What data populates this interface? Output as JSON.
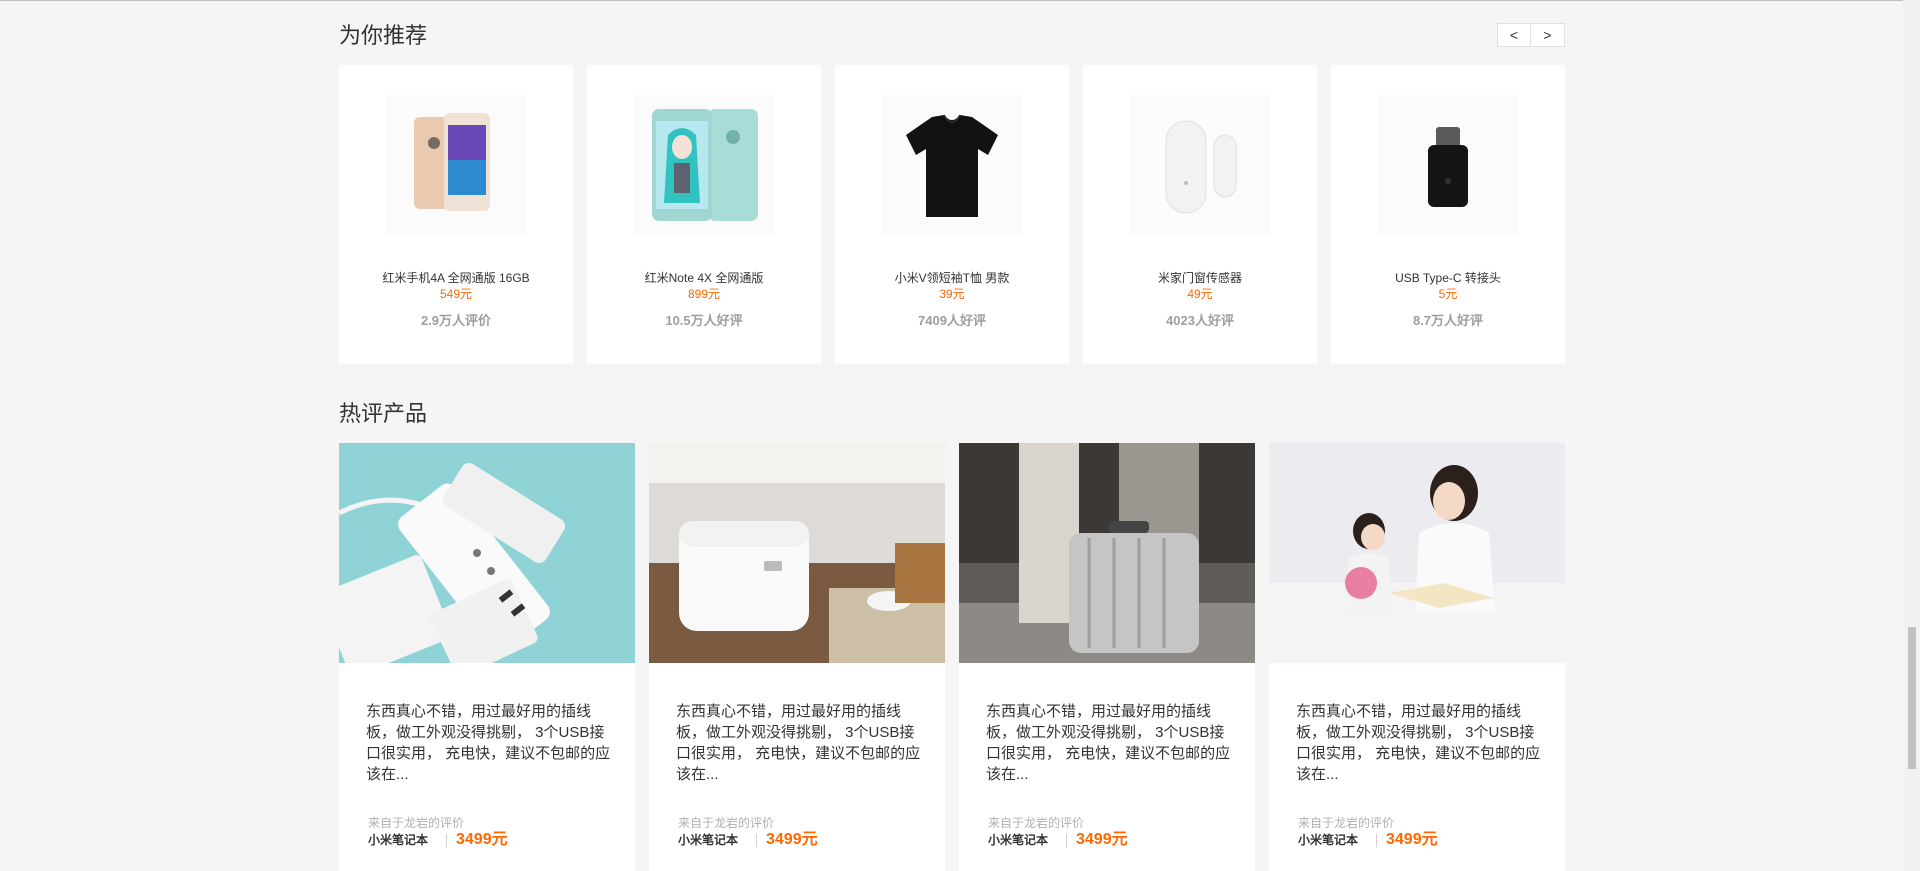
{
  "recommend": {
    "title": "为你推荐",
    "prev_label": "<",
    "next_label": ">",
    "items": [
      {
        "name": "红米手机4A 全网通版 16GB",
        "price": "549元",
        "reviews": "2.9万人评价"
      },
      {
        "name": "红米Note 4X 全网通版",
        "price": "899元",
        "reviews": "10.5万人好评"
      },
      {
        "name": "小米V领短袖T恤 男款",
        "price": "39元",
        "reviews": "7409人好评"
      },
      {
        "name": "米家门窗传感器",
        "price": "49元",
        "reviews": "4023人好评"
      },
      {
        "name": "USB Type-C 转接头",
        "price": "5元",
        "reviews": "8.7万人好评"
      }
    ]
  },
  "hot": {
    "title": "热评产品",
    "items": [
      {
        "text": "东西真心不错，用过最好用的插线板，做工外观没得挑剔， 3个USB接口很实用， 充电快，建议不包邮的应该在...",
        "from": "来自于龙岩的评价",
        "product": "小米笔记本",
        "price": "3499元"
      },
      {
        "text": "东西真心不错，用过最好用的插线板，做工外观没得挑剔， 3个USB接口很实用， 充电快，建议不包邮的应该在...",
        "from": "来自于龙岩的评价",
        "product": "小米笔记本",
        "price": "3499元"
      },
      {
        "text": "东西真心不错，用过最好用的插线板，做工外观没得挑剔， 3个USB接口很实用， 充电快，建议不包邮的应该在...",
        "from": "来自于龙岩的评价",
        "product": "小米笔记本",
        "price": "3499元"
      },
      {
        "text": "东西真心不错，用过最好用的插线板，做工外观没得挑剔， 3个USB接口很实用， 充电快，建议不包邮的应该在...",
        "from": "来自于龙岩的评价",
        "product": "小米笔记本",
        "price": "3499元"
      }
    ]
  },
  "colors": {
    "accent": "#ff6700",
    "background": "#f5f5f5"
  }
}
